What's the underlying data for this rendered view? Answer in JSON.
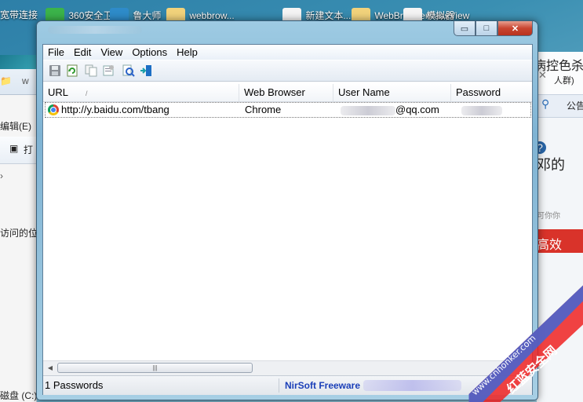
{
  "desktop": {
    "icons": [
      {
        "label": "宽带连接"
      },
      {
        "label": "360安全卫士"
      },
      {
        "label": "鲁大师"
      },
      {
        "label": "webbrow..."
      },
      {
        "label": "新建文本..."
      },
      {
        "label": "WebBrowserPassView"
      },
      {
        "label": "模拟器"
      }
    ]
  },
  "background_left": {
    "menu_text": "编辑(E)",
    "print_text": "打",
    "visited_text": "访问的位",
    "disk_text": "磁盘 (C:)",
    "arrow": "›",
    "folder_text": "w"
  },
  "background_right": {
    "title_text": "病控色杀",
    "line1": "人群)",
    "notice": "公告",
    "big_text": "邓的",
    "small_text": "可你你",
    "red_text": "高效"
  },
  "window": {
    "title": "",
    "controls": {
      "minimize": "▭",
      "maximize": "□",
      "close": "✕"
    }
  },
  "menubar": [
    "File",
    "Edit",
    "View",
    "Options",
    "Help"
  ],
  "toolbar": [
    {
      "icon": "save-icon"
    },
    {
      "icon": "refresh-icon"
    },
    {
      "icon": "copy-icon"
    },
    {
      "icon": "properties-icon"
    },
    {
      "icon": "find-icon"
    },
    {
      "icon": "exit-icon"
    }
  ],
  "columns": [
    "URL",
    "Web Browser",
    "User Name",
    "Password"
  ],
  "rows": [
    {
      "url": "http://y.baidu.com/tbang",
      "browser": "Chrome",
      "username": "@qq.com",
      "password": ""
    }
  ],
  "status": {
    "count": "1 Passwords",
    "link": "NirSoft Freeware"
  },
  "watermark": {
    "url_text": "www.cnhonker.com",
    "brand": "红蓝安全网"
  }
}
